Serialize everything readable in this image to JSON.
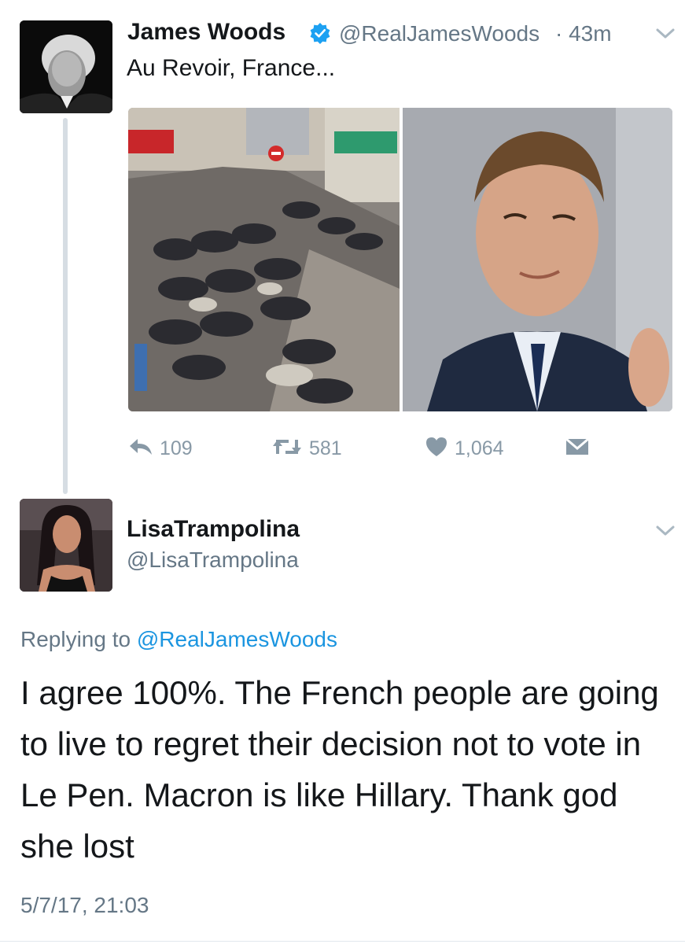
{
  "tweet": {
    "author_name": "James Woods",
    "handle": "@RealJamesWoods",
    "time": "· 43m",
    "text": "Au Revoir, France...",
    "actions": {
      "reply_count": "109",
      "retweet_count": "581",
      "like_count": "1,064"
    },
    "icons": [
      "verified-badge-icon",
      "chevron-down-icon",
      "reply-icon",
      "retweet-icon",
      "heart-icon",
      "direct-message-icon"
    ]
  },
  "reply": {
    "author_name": "LisaTrampolina",
    "handle": "@LisaTrampolina",
    "replying_prefix": "Replying to ",
    "replying_to": "@RealJamesWoods",
    "text": "I agree 100%. The French people are going to live to regret their decision not to vote in Le Pen. Macron is like Hillary. Thank god she lost",
    "timestamp": "5/7/17, 21:03"
  },
  "colors": {
    "link": "#1b95e0",
    "secondary_text": "#657786",
    "action_gray": "#8899a6",
    "verified": "#1da1f2",
    "thread_line": "#d6dde3"
  }
}
